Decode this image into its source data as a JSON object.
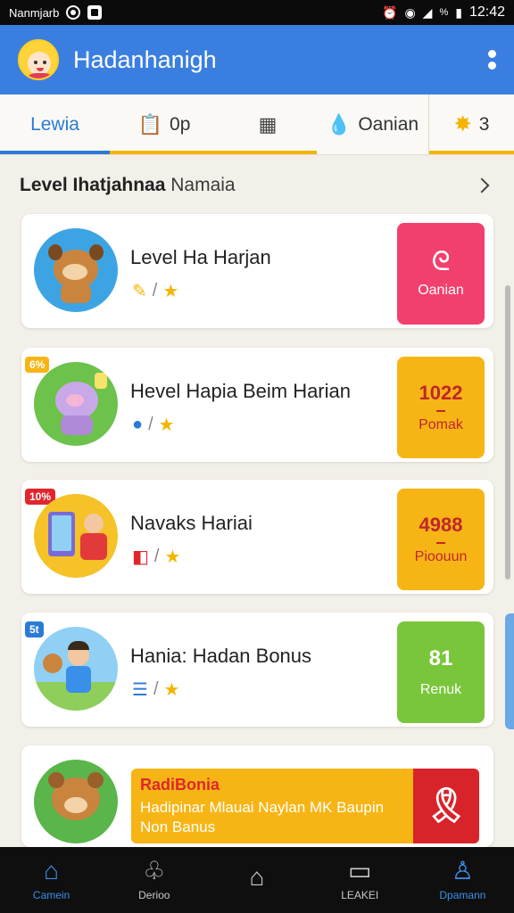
{
  "status_bar": {
    "left_text": "Nanmjarb",
    "percent": "%",
    "time": "12:42"
  },
  "app_bar": {
    "title": "Hadanhanigh"
  },
  "tabs": [
    {
      "label": "Lewia",
      "icon": "",
      "active": true
    },
    {
      "label": "0p",
      "icon": "clipboard-icon"
    },
    {
      "label": "",
      "icon": "calculator-icon"
    },
    {
      "label": "Oanian",
      "icon": "water-drop-icon"
    },
    {
      "label": "3",
      "icon": "gear-icon"
    }
  ],
  "section": {
    "title_bold": "Level Ihatjahnaa",
    "title_rest": "Namaia"
  },
  "cards": [
    {
      "title": "Level Ha Harjan",
      "tag": "",
      "side": {
        "label": "Oanian",
        "value": "",
        "sub": "",
        "color": "#f2406e"
      }
    },
    {
      "title": "Hevel Hapia Beim Harian",
      "tag": "6%",
      "side": {
        "value": "1022",
        "sub": "Pomak",
        "color": "#f7b515"
      }
    },
    {
      "title": "Navaks Hariai",
      "tag": "10%",
      "side": {
        "value": "4988",
        "sub": "Pioouun",
        "color": "#f7b515"
      }
    },
    {
      "title": "Hania: Hadan Bonus",
      "tag": "5t",
      "side": {
        "value": "81",
        "sub": "Renuk",
        "color": "#79c63a"
      }
    }
  ],
  "promo": {
    "title": "RadiBonia",
    "line1": "Hadipinar Mlauai Naylan MK Baupin",
    "line2": "Non Banus"
  },
  "bottom_nav": [
    {
      "label": "Camein",
      "icon": "home-icon",
      "active": true
    },
    {
      "label": "Derioo",
      "icon": "tree-icon"
    },
    {
      "label": "",
      "icon": "house-outline-icon"
    },
    {
      "label": "LEAKEI",
      "icon": "inbox-icon"
    },
    {
      "label": "Dpamann",
      "icon": "person-icon",
      "active": true
    }
  ]
}
